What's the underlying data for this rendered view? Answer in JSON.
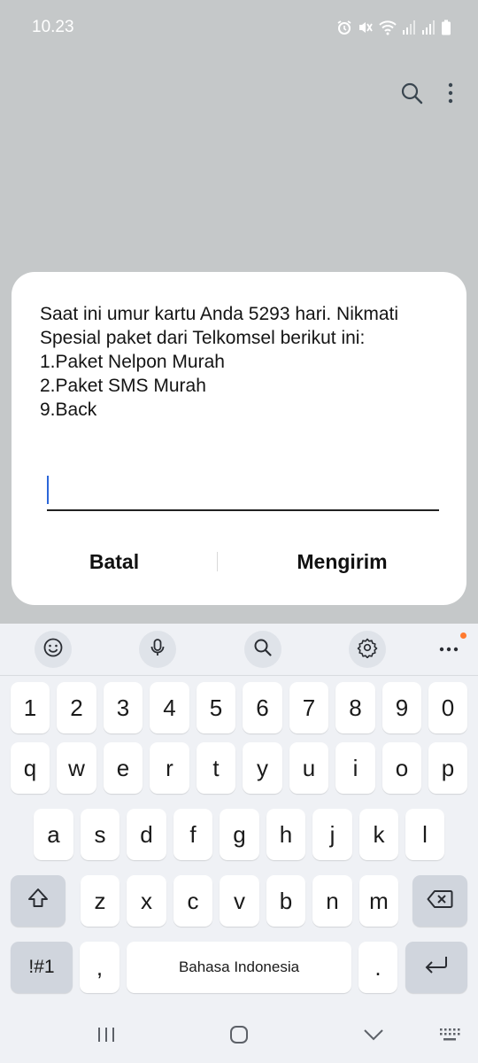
{
  "status_bar": {
    "time": "10.23",
    "icons": [
      "alarm-icon",
      "mute-icon",
      "wifi-icon",
      "signal-icon",
      "signal-icon",
      "battery-icon"
    ]
  },
  "app_bar": {
    "icons": [
      "search-icon",
      "more-options-icon"
    ]
  },
  "ussd_dialog": {
    "message_lines": [
      "Saat ini umur kartu Anda 5293 hari. Nikmati",
      "Spesial paket dari Telkomsel berikut ini:",
      "1.Paket Nelpon Murah",
      "2.Paket SMS Murah",
      "9.Back"
    ],
    "input_value": "",
    "cancel_label": "Batal",
    "send_label": "Mengirim"
  },
  "keyboard": {
    "toolbar_icons": [
      "emoji-icon",
      "microphone-icon",
      "search-icon",
      "settings-icon",
      "more-options-icon"
    ],
    "number_row": [
      "1",
      "2",
      "3",
      "4",
      "5",
      "6",
      "7",
      "8",
      "9",
      "0"
    ],
    "row1": [
      "q",
      "w",
      "e",
      "r",
      "t",
      "y",
      "u",
      "i",
      "o",
      "p"
    ],
    "row2": [
      "a",
      "s",
      "d",
      "f",
      "g",
      "h",
      "j",
      "k",
      "l"
    ],
    "row3": [
      "z",
      "x",
      "c",
      "v",
      "b",
      "n",
      "m"
    ],
    "shift_icon": "shift-icon",
    "backspace_icon": "backspace-icon",
    "symbols_label": "!#1",
    "comma_label": ",",
    "space_label": "Bahasa Indonesia",
    "period_label": ".",
    "enter_icon": "enter-icon"
  },
  "nav_bar": {
    "icons": [
      "recent-apps-icon",
      "home-icon",
      "back-icon",
      "keyboard-switch-icon"
    ]
  },
  "colors": {
    "dim_background": "#c5c8c9",
    "cursor": "#2b66d9",
    "notification_dot": "#ff7a2f",
    "keyboard_background": "#eff1f5",
    "function_key": "#d0d5dd"
  }
}
